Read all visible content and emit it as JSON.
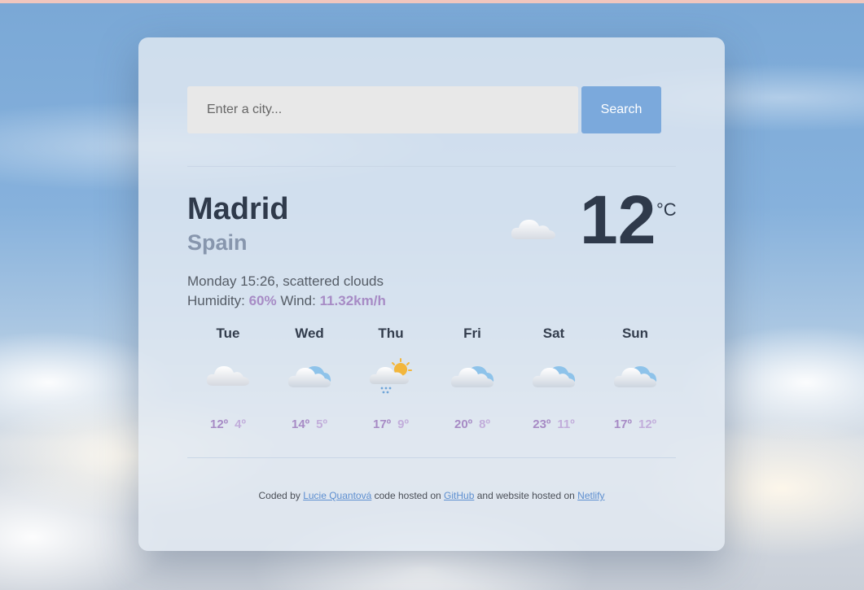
{
  "search": {
    "placeholder": "Enter a city...",
    "button_label": "Search"
  },
  "current": {
    "city": "Madrid",
    "country": "Spain",
    "description": "Monday 15:26, scattered clouds",
    "humidity_label": "Humidity:",
    "humidity": "60%",
    "wind_label": "Wind:",
    "wind": "11.32km/h",
    "temperature": "12",
    "unit": "°C",
    "icon": "cloud-icon"
  },
  "forecast": [
    {
      "day": "Tue",
      "max": "12º",
      "min": "4º",
      "icon": "cloud-icon"
    },
    {
      "day": "Wed",
      "max": "14º",
      "min": "5º",
      "icon": "cloud-blue-icon"
    },
    {
      "day": "Thu",
      "max": "17º",
      "min": "9º",
      "icon": "rain-sun-cloud-icon"
    },
    {
      "day": "Fri",
      "max": "20º",
      "min": "8º",
      "icon": "cloud-blue-icon"
    },
    {
      "day": "Sat",
      "max": "23º",
      "min": "11º",
      "icon": "cloud-blue-icon"
    },
    {
      "day": "Sun",
      "max": "17º",
      "min": "12º",
      "icon": "cloud-blue-icon"
    }
  ],
  "footer": {
    "prefix": "Coded by",
    "author_link": "Lucie Quantová",
    "middle": "code hosted on",
    "github_link": "GitHub",
    "middle2": "and website hosted on",
    "netlify_link": "Netlify"
  },
  "colors": {
    "accent": "#7ba9dc",
    "highlight": "#a78bc5",
    "text_dark": "#2f3a4b"
  }
}
